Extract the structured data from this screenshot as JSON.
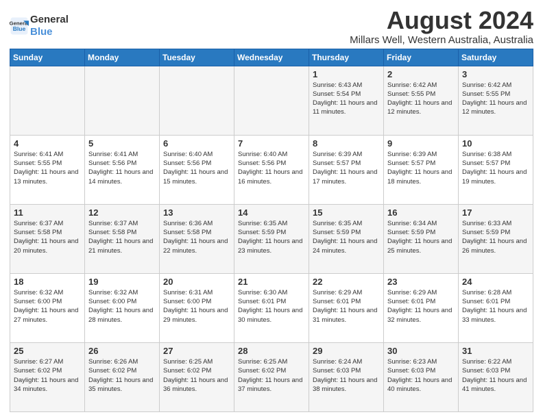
{
  "logo": {
    "line1": "General",
    "line2": "Blue"
  },
  "header": {
    "month": "August 2024",
    "location": "Millars Well, Western Australia, Australia"
  },
  "weekdays": [
    "Sunday",
    "Monday",
    "Tuesday",
    "Wednesday",
    "Thursday",
    "Friday",
    "Saturday"
  ],
  "weeks": [
    [
      {
        "day": "",
        "sunrise": "",
        "sunset": "",
        "daylight": ""
      },
      {
        "day": "",
        "sunrise": "",
        "sunset": "",
        "daylight": ""
      },
      {
        "day": "",
        "sunrise": "",
        "sunset": "",
        "daylight": ""
      },
      {
        "day": "",
        "sunrise": "",
        "sunset": "",
        "daylight": ""
      },
      {
        "day": "1",
        "sunrise": "Sunrise: 6:43 AM",
        "sunset": "Sunset: 5:54 PM",
        "daylight": "Daylight: 11 hours and 11 minutes."
      },
      {
        "day": "2",
        "sunrise": "Sunrise: 6:42 AM",
        "sunset": "Sunset: 5:55 PM",
        "daylight": "Daylight: 11 hours and 12 minutes."
      },
      {
        "day": "3",
        "sunrise": "Sunrise: 6:42 AM",
        "sunset": "Sunset: 5:55 PM",
        "daylight": "Daylight: 11 hours and 12 minutes."
      }
    ],
    [
      {
        "day": "4",
        "sunrise": "Sunrise: 6:41 AM",
        "sunset": "Sunset: 5:55 PM",
        "daylight": "Daylight: 11 hours and 13 minutes."
      },
      {
        "day": "5",
        "sunrise": "Sunrise: 6:41 AM",
        "sunset": "Sunset: 5:56 PM",
        "daylight": "Daylight: 11 hours and 14 minutes."
      },
      {
        "day": "6",
        "sunrise": "Sunrise: 6:40 AM",
        "sunset": "Sunset: 5:56 PM",
        "daylight": "Daylight: 11 hours and 15 minutes."
      },
      {
        "day": "7",
        "sunrise": "Sunrise: 6:40 AM",
        "sunset": "Sunset: 5:56 PM",
        "daylight": "Daylight: 11 hours and 16 minutes."
      },
      {
        "day": "8",
        "sunrise": "Sunrise: 6:39 AM",
        "sunset": "Sunset: 5:57 PM",
        "daylight": "Daylight: 11 hours and 17 minutes."
      },
      {
        "day": "9",
        "sunrise": "Sunrise: 6:39 AM",
        "sunset": "Sunset: 5:57 PM",
        "daylight": "Daylight: 11 hours and 18 minutes."
      },
      {
        "day": "10",
        "sunrise": "Sunrise: 6:38 AM",
        "sunset": "Sunset: 5:57 PM",
        "daylight": "Daylight: 11 hours and 19 minutes."
      }
    ],
    [
      {
        "day": "11",
        "sunrise": "Sunrise: 6:37 AM",
        "sunset": "Sunset: 5:58 PM",
        "daylight": "Daylight: 11 hours and 20 minutes."
      },
      {
        "day": "12",
        "sunrise": "Sunrise: 6:37 AM",
        "sunset": "Sunset: 5:58 PM",
        "daylight": "Daylight: 11 hours and 21 minutes."
      },
      {
        "day": "13",
        "sunrise": "Sunrise: 6:36 AM",
        "sunset": "Sunset: 5:58 PM",
        "daylight": "Daylight: 11 hours and 22 minutes."
      },
      {
        "day": "14",
        "sunrise": "Sunrise: 6:35 AM",
        "sunset": "Sunset: 5:59 PM",
        "daylight": "Daylight: 11 hours and 23 minutes."
      },
      {
        "day": "15",
        "sunrise": "Sunrise: 6:35 AM",
        "sunset": "Sunset: 5:59 PM",
        "daylight": "Daylight: 11 hours and 24 minutes."
      },
      {
        "day": "16",
        "sunrise": "Sunrise: 6:34 AM",
        "sunset": "Sunset: 5:59 PM",
        "daylight": "Daylight: 11 hours and 25 minutes."
      },
      {
        "day": "17",
        "sunrise": "Sunrise: 6:33 AM",
        "sunset": "Sunset: 5:59 PM",
        "daylight": "Daylight: 11 hours and 26 minutes."
      }
    ],
    [
      {
        "day": "18",
        "sunrise": "Sunrise: 6:32 AM",
        "sunset": "Sunset: 6:00 PM",
        "daylight": "Daylight: 11 hours and 27 minutes."
      },
      {
        "day": "19",
        "sunrise": "Sunrise: 6:32 AM",
        "sunset": "Sunset: 6:00 PM",
        "daylight": "Daylight: 11 hours and 28 minutes."
      },
      {
        "day": "20",
        "sunrise": "Sunrise: 6:31 AM",
        "sunset": "Sunset: 6:00 PM",
        "daylight": "Daylight: 11 hours and 29 minutes."
      },
      {
        "day": "21",
        "sunrise": "Sunrise: 6:30 AM",
        "sunset": "Sunset: 6:01 PM",
        "daylight": "Daylight: 11 hours and 30 minutes."
      },
      {
        "day": "22",
        "sunrise": "Sunrise: 6:29 AM",
        "sunset": "Sunset: 6:01 PM",
        "daylight": "Daylight: 11 hours and 31 minutes."
      },
      {
        "day": "23",
        "sunrise": "Sunrise: 6:29 AM",
        "sunset": "Sunset: 6:01 PM",
        "daylight": "Daylight: 11 hours and 32 minutes."
      },
      {
        "day": "24",
        "sunrise": "Sunrise: 6:28 AM",
        "sunset": "Sunset: 6:01 PM",
        "daylight": "Daylight: 11 hours and 33 minutes."
      }
    ],
    [
      {
        "day": "25",
        "sunrise": "Sunrise: 6:27 AM",
        "sunset": "Sunset: 6:02 PM",
        "daylight": "Daylight: 11 hours and 34 minutes."
      },
      {
        "day": "26",
        "sunrise": "Sunrise: 6:26 AM",
        "sunset": "Sunset: 6:02 PM",
        "daylight": "Daylight: 11 hours and 35 minutes."
      },
      {
        "day": "27",
        "sunrise": "Sunrise: 6:25 AM",
        "sunset": "Sunset: 6:02 PM",
        "daylight": "Daylight: 11 hours and 36 minutes."
      },
      {
        "day": "28",
        "sunrise": "Sunrise: 6:25 AM",
        "sunset": "Sunset: 6:02 PM",
        "daylight": "Daylight: 11 hours and 37 minutes."
      },
      {
        "day": "29",
        "sunrise": "Sunrise: 6:24 AM",
        "sunset": "Sunset: 6:03 PM",
        "daylight": "Daylight: 11 hours and 38 minutes."
      },
      {
        "day": "30",
        "sunrise": "Sunrise: 6:23 AM",
        "sunset": "Sunset: 6:03 PM",
        "daylight": "Daylight: 11 hours and 40 minutes."
      },
      {
        "day": "31",
        "sunrise": "Sunrise: 6:22 AM",
        "sunset": "Sunset: 6:03 PM",
        "daylight": "Daylight: 11 hours and 41 minutes."
      }
    ]
  ]
}
